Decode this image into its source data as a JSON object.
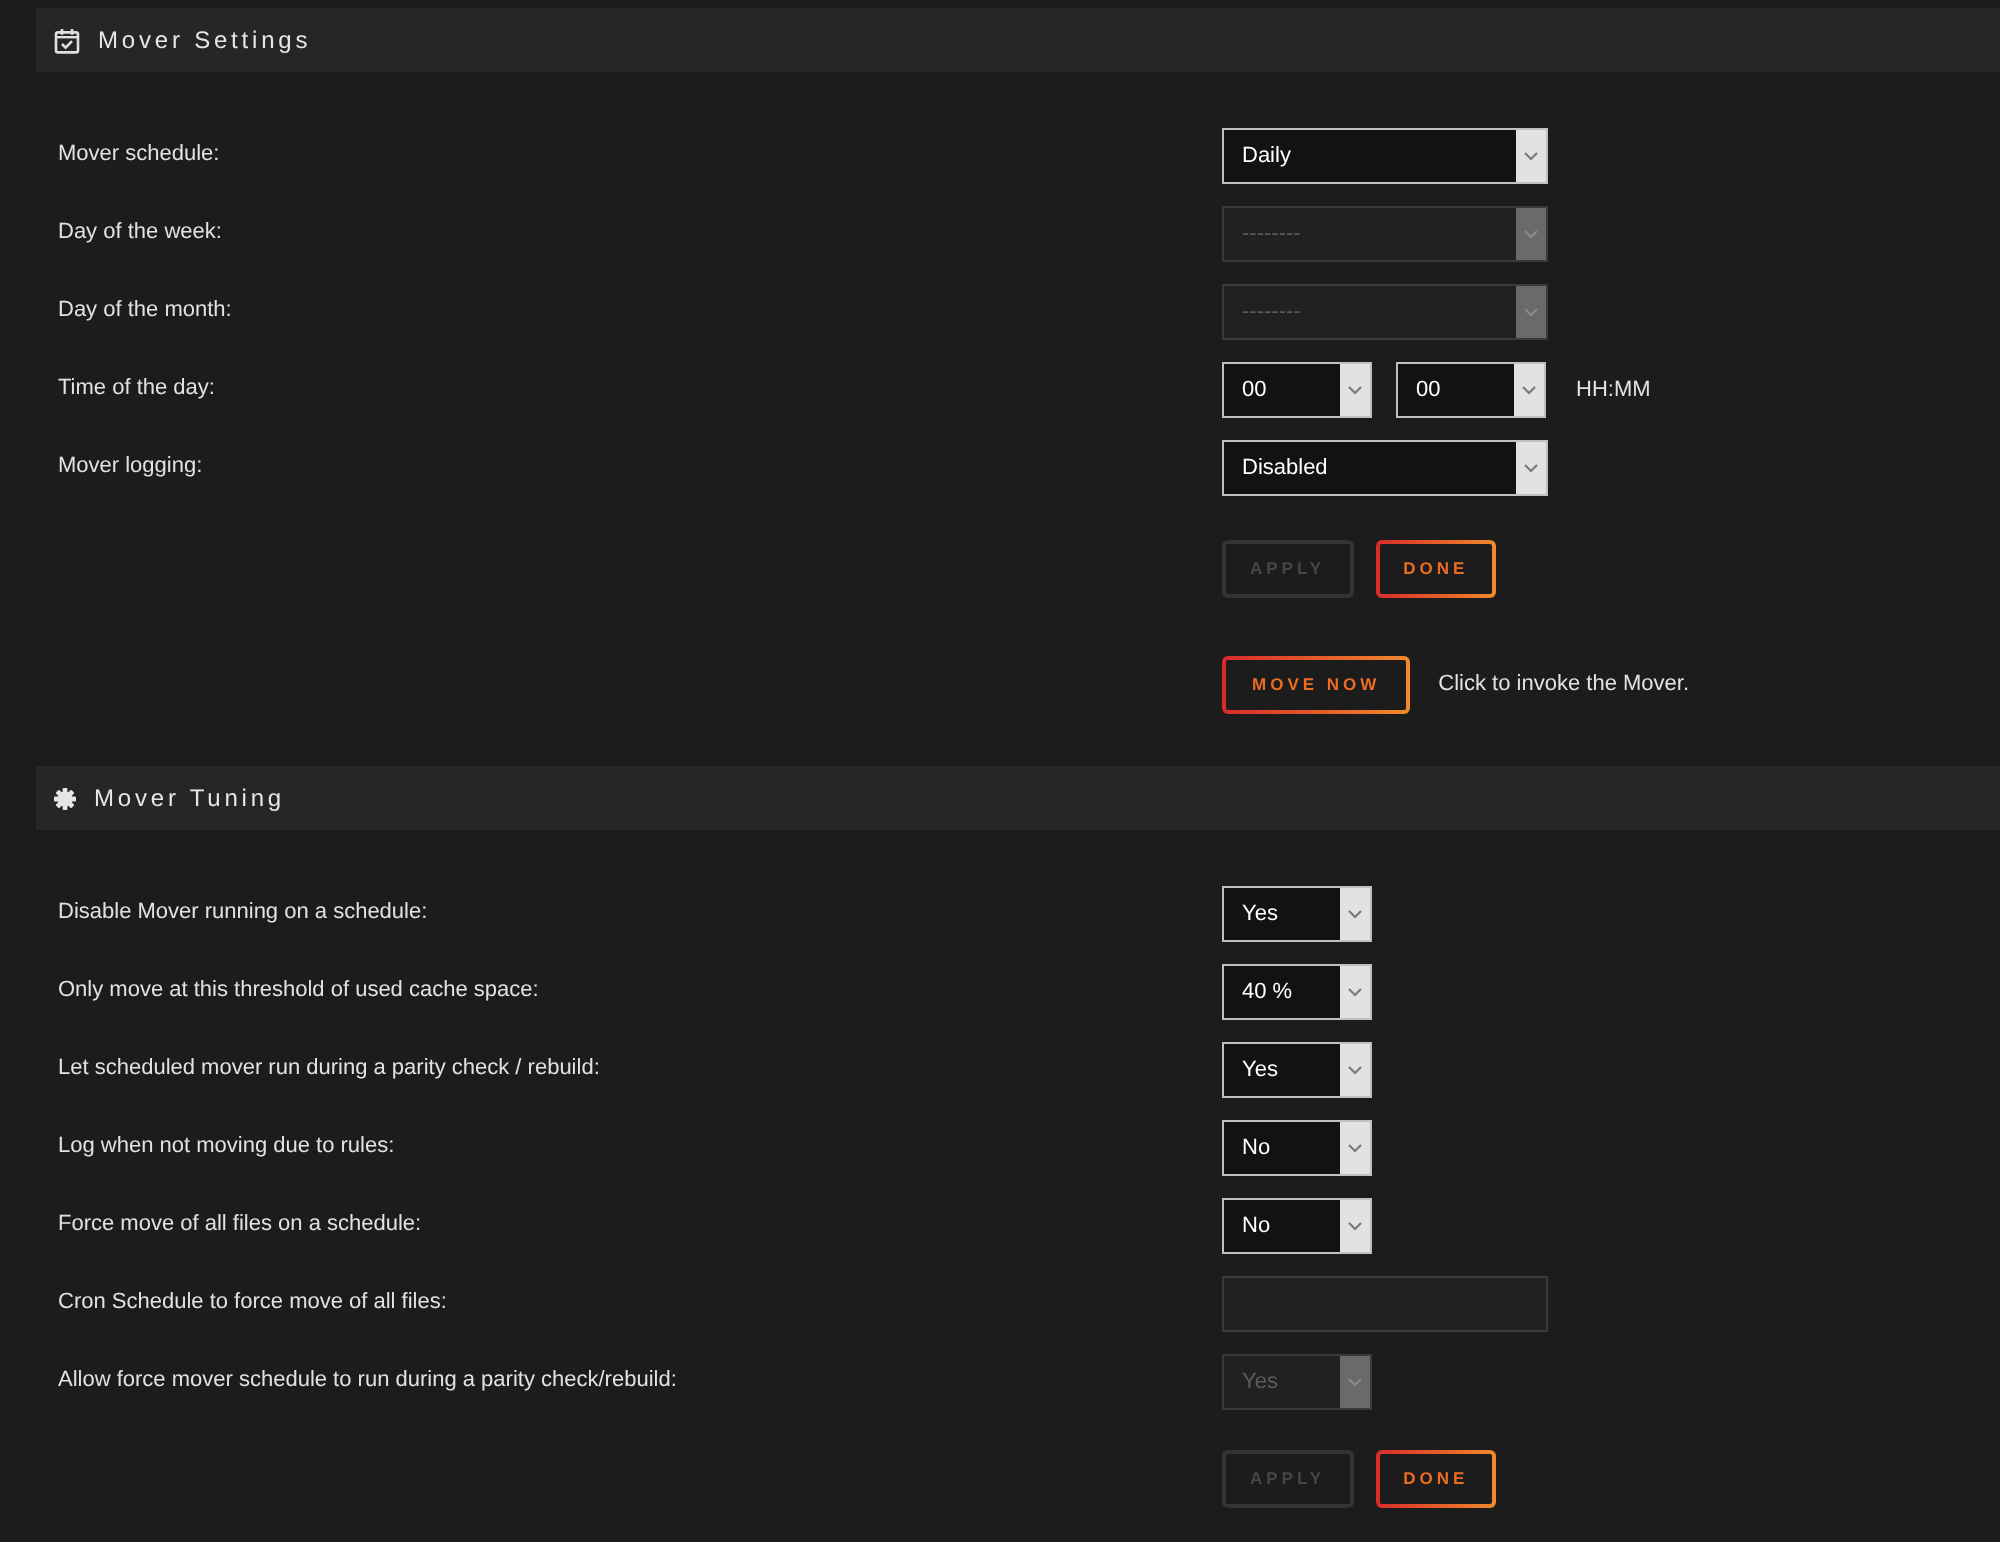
{
  "sections": [
    {
      "title": "Mover Settings",
      "rows": [
        {
          "label": "Mover schedule:",
          "fields": [
            {
              "kind": "dropdown",
              "value": "Daily",
              "disabled": false
            }
          ]
        },
        {
          "label": "Day of the week:",
          "fields": [
            {
              "kind": "dropdown",
              "value": "--------",
              "disabled": true
            }
          ]
        },
        {
          "label": "Day of the month:",
          "fields": [
            {
              "kind": "dropdown",
              "value": "--------",
              "disabled": true
            }
          ]
        },
        {
          "label": "Time of the day:",
          "fields": [
            {
              "kind": "compact-dropdown",
              "value": "00",
              "disabled": false
            },
            {
              "kind": "compact-dropdown",
              "value": "00",
              "disabled": false
            }
          ],
          "hint": "HH:MM"
        },
        {
          "label": "Mover logging:",
          "fields": [
            {
              "kind": "dropdown",
              "value": "Disabled",
              "disabled": false
            }
          ]
        }
      ],
      "buttons": [
        {
          "label": "APPLY",
          "disabled": true
        },
        {
          "label": "DONE",
          "disabled": false
        }
      ],
      "move_now": {
        "label": "MOVE NOW",
        "note": "Click to invoke the Mover."
      }
    },
    {
      "title": "Mover Tuning",
      "rows": [
        {
          "label": "Disable Mover running on a schedule:",
          "fields": [
            {
              "kind": "compact-dropdown",
              "value": "Yes",
              "disabled": false
            }
          ]
        },
        {
          "label": "Only move at this threshold of used cache space:",
          "fields": [
            {
              "kind": "compact-dropdown",
              "value": "40 %",
              "disabled": false
            }
          ]
        },
        {
          "label": "Let scheduled mover run during a parity check / rebuild:",
          "fields": [
            {
              "kind": "compact-dropdown",
              "value": "Yes",
              "disabled": false
            }
          ]
        },
        {
          "label": "Log when not moving due to rules:",
          "fields": [
            {
              "kind": "compact-dropdown",
              "value": "No",
              "disabled": false
            }
          ]
        },
        {
          "label": "Force move of all files on a schedule:",
          "fields": [
            {
              "kind": "compact-dropdown",
              "value": "No",
              "disabled": false
            }
          ]
        },
        {
          "label": "Cron Schedule to force move of all files:",
          "fields": [
            {
              "kind": "text-input",
              "disabled": true
            }
          ]
        },
        {
          "label": "Allow force mover schedule to run during a parity check/rebuild:",
          "fields": [
            {
              "kind": "compact-dropdown",
              "value": "Yes",
              "disabled": true
            }
          ]
        }
      ],
      "buttons": [
        {
          "label": "APPLY",
          "disabled": true
        },
        {
          "label": "DONE",
          "disabled": false
        }
      ]
    }
  ]
}
